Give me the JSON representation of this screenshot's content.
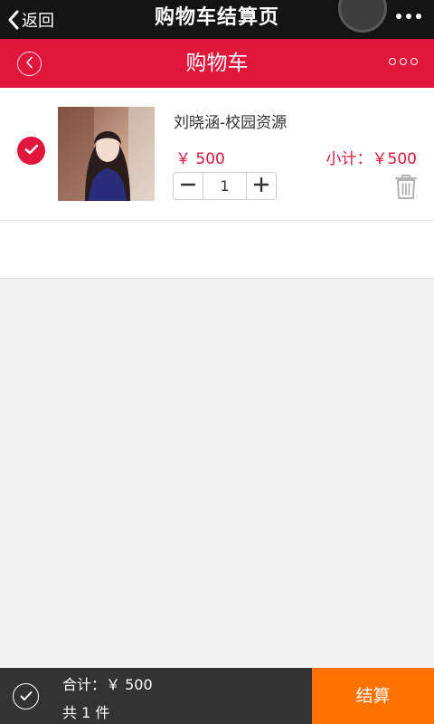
{
  "topbar": {
    "back_label": "返回",
    "title": "购物车结算页"
  },
  "header": {
    "title": "购物车"
  },
  "cart": {
    "items": [
      {
        "name": "刘晓涵-校园资源",
        "price": "￥ 500",
        "subtotal": "小计：￥500",
        "quantity": "1",
        "checked": true
      }
    ]
  },
  "footer": {
    "total": "合计：￥ 500",
    "count": "共 1 件",
    "checkout_label": "结算"
  },
  "colors": {
    "accent": "#e1163c",
    "checkout": "#ff7200",
    "topbar": "#141414",
    "footer": "#333333"
  }
}
